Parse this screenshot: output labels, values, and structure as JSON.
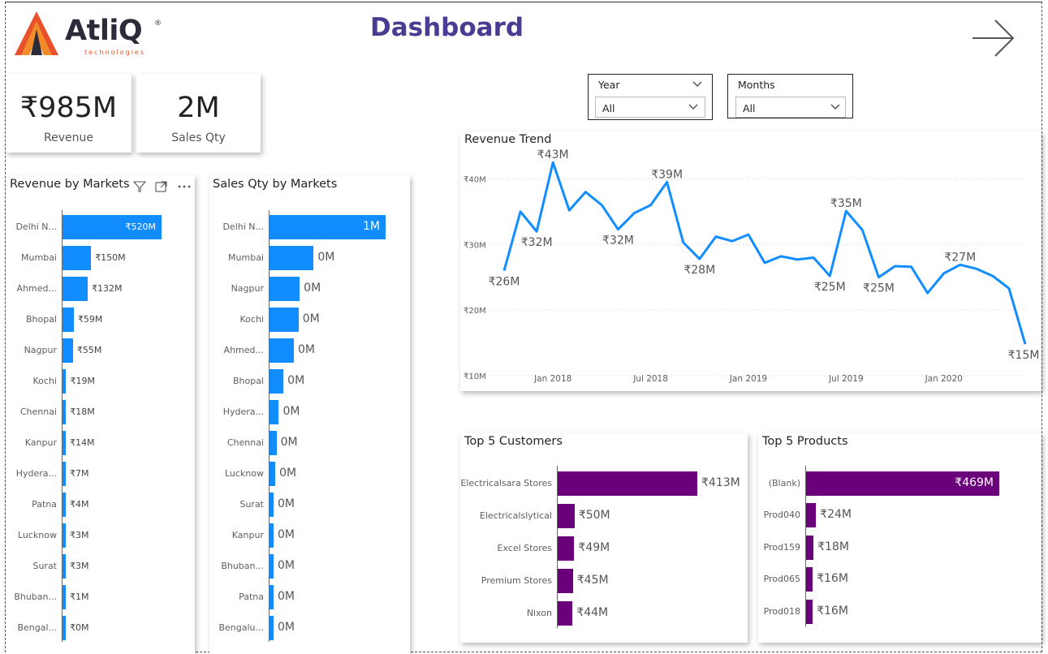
{
  "logo": {
    "name": "AtliQ",
    "registered": "®",
    "subtitle": "technologies"
  },
  "header": {
    "title": "Dashboard",
    "nav_icon": "arrow-right-icon"
  },
  "kpis": [
    {
      "value": "₹985M",
      "label": "Revenue"
    },
    {
      "value": "2M",
      "label": "Sales Qty"
    }
  ],
  "slicers": [
    {
      "title": "Year",
      "value": "All"
    },
    {
      "title": "Months",
      "value": "All"
    }
  ],
  "colors": {
    "bar_blue": "#118DFF",
    "bar_purple": "#6B007B",
    "line": "#118DFF",
    "title_purple": "#4a3c92"
  },
  "revenue_by_markets": {
    "title": "Revenue by Markets",
    "header_icons": [
      "filter-icon",
      "focus-mode-icon",
      "more-options-icon"
    ]
  },
  "sales_qty_by_markets": {
    "title": "Sales Qty by Markets"
  },
  "revenue_trend": {
    "title": "Revenue Trend"
  },
  "top_customers": {
    "title": "Top 5 Customers"
  },
  "top_products": {
    "title": "Top 5 Products"
  },
  "chart_data": [
    {
      "id": "revenue_by_markets",
      "type": "bar",
      "orientation": "horizontal",
      "title": "Revenue by Markets",
      "categories": [
        "Delhi N...",
        "Mumbai",
        "Ahmed...",
        "Bhopal",
        "Nagpur",
        "Kochi",
        "Chennai",
        "Kanpur",
        "Hydera...",
        "Patna",
        "Lucknow",
        "Surat",
        "Bhuban...",
        "Bengal..."
      ],
      "values": [
        520,
        150,
        132,
        59,
        55,
        19,
        18,
        14,
        7,
        4,
        3,
        3,
        1,
        0
      ],
      "labels": [
        "₹520M",
        "₹150M",
        "₹132M",
        "₹59M",
        "₹55M",
        "₹19M",
        "₹18M",
        "₹14M",
        "₹7M",
        "₹4M",
        "₹3M",
        "₹3M",
        "₹1M",
        "₹0M"
      ],
      "unit": "₹M"
    },
    {
      "id": "sales_qty_by_markets",
      "type": "bar",
      "orientation": "horizontal",
      "title": "Sales Qty by Markets",
      "categories": [
        "Delhi N...",
        "Mumbai",
        "Nagpur",
        "Kochi",
        "Ahmed...",
        "Bhopal",
        "Hydera...",
        "Chennai",
        "Lucknow",
        "Surat",
        "Kanpur",
        "Bhuban...",
        "Patna",
        "Bengalu..."
      ],
      "values": [
        1.0,
        0.38,
        0.26,
        0.25,
        0.21,
        0.12,
        0.08,
        0.06,
        0.05,
        0.03,
        0.03,
        0.02,
        0.02,
        0.01
      ],
      "labels": [
        "1M",
        "0M",
        "0M",
        "0M",
        "0M",
        "0M",
        "0M",
        "0M",
        "0M",
        "0M",
        "0M",
        "0M",
        "0M",
        "0M"
      ],
      "unit": "M"
    },
    {
      "id": "revenue_trend",
      "type": "line",
      "title": "Revenue Trend",
      "x_ticks": [
        "Jan 2018",
        "Jul 2018",
        "Jan 2019",
        "Jul 2019",
        "Jan 2020"
      ],
      "y_ticks": [
        "₹10M",
        "₹20M",
        "₹30M",
        "₹40M"
      ],
      "ylim": [
        10,
        45
      ],
      "x": [
        "2017-10",
        "2017-11",
        "2017-12",
        "2018-01",
        "2018-02",
        "2018-03",
        "2018-04",
        "2018-05",
        "2018-06",
        "2018-07",
        "2018-08",
        "2018-09",
        "2018-10",
        "2018-11",
        "2018-12",
        "2019-01",
        "2019-02",
        "2019-03",
        "2019-04",
        "2019-05",
        "2019-06",
        "2019-07",
        "2019-08",
        "2019-09",
        "2019-10",
        "2019-11",
        "2019-12",
        "2020-01",
        "2020-02",
        "2020-03",
        "2020-04",
        "2020-05",
        "2020-06"
      ],
      "values": [
        26.0,
        35.0,
        32.0,
        42.5,
        35.2,
        38.0,
        36.0,
        32.3,
        34.8,
        36.0,
        39.5,
        30.3,
        27.8,
        31.2,
        30.5,
        31.5,
        27.2,
        28.2,
        27.7,
        28.0,
        25.2,
        35.1,
        32.2,
        25.0,
        26.7,
        26.6,
        22.6,
        25.6,
        26.9,
        26.3,
        25.2,
        23.3,
        14.8
      ],
      "data_labels": [
        {
          "index": 0,
          "text": "₹26M"
        },
        {
          "index": 2,
          "text": "₹32M"
        },
        {
          "index": 3,
          "text": "₹43M"
        },
        {
          "index": 7,
          "text": "₹32M"
        },
        {
          "index": 10,
          "text": "₹39M"
        },
        {
          "index": 12,
          "text": "₹28M"
        },
        {
          "index": 20,
          "text": "₹25M"
        },
        {
          "index": 21,
          "text": "₹35M"
        },
        {
          "index": 23,
          "text": "₹25M"
        },
        {
          "index": 28,
          "text": "₹27M"
        },
        {
          "index": 32,
          "text": "₹15M"
        }
      ],
      "grid": true
    },
    {
      "id": "top_customers",
      "type": "bar",
      "orientation": "horizontal",
      "title": "Top 5 Customers",
      "categories": [
        "Electricalsara Stores",
        "Electricalslytical",
        "Excel Stores",
        "Premium Stores",
        "Nixon"
      ],
      "values": [
        413,
        50,
        49,
        45,
        44
      ],
      "labels": [
        "₹413M",
        "₹50M",
        "₹49M",
        "₹45M",
        "₹44M"
      ],
      "unit": "₹M"
    },
    {
      "id": "top_products",
      "type": "bar",
      "orientation": "horizontal",
      "title": "Top 5 Products",
      "categories": [
        "(Blank)",
        "Prod040",
        "Prod159",
        "Prod065",
        "Prod018"
      ],
      "values": [
        469,
        24,
        18,
        16,
        16
      ],
      "labels": [
        "₹469M",
        "₹24M",
        "₹18M",
        "₹16M",
        "₹16M"
      ],
      "unit": "₹M"
    }
  ]
}
